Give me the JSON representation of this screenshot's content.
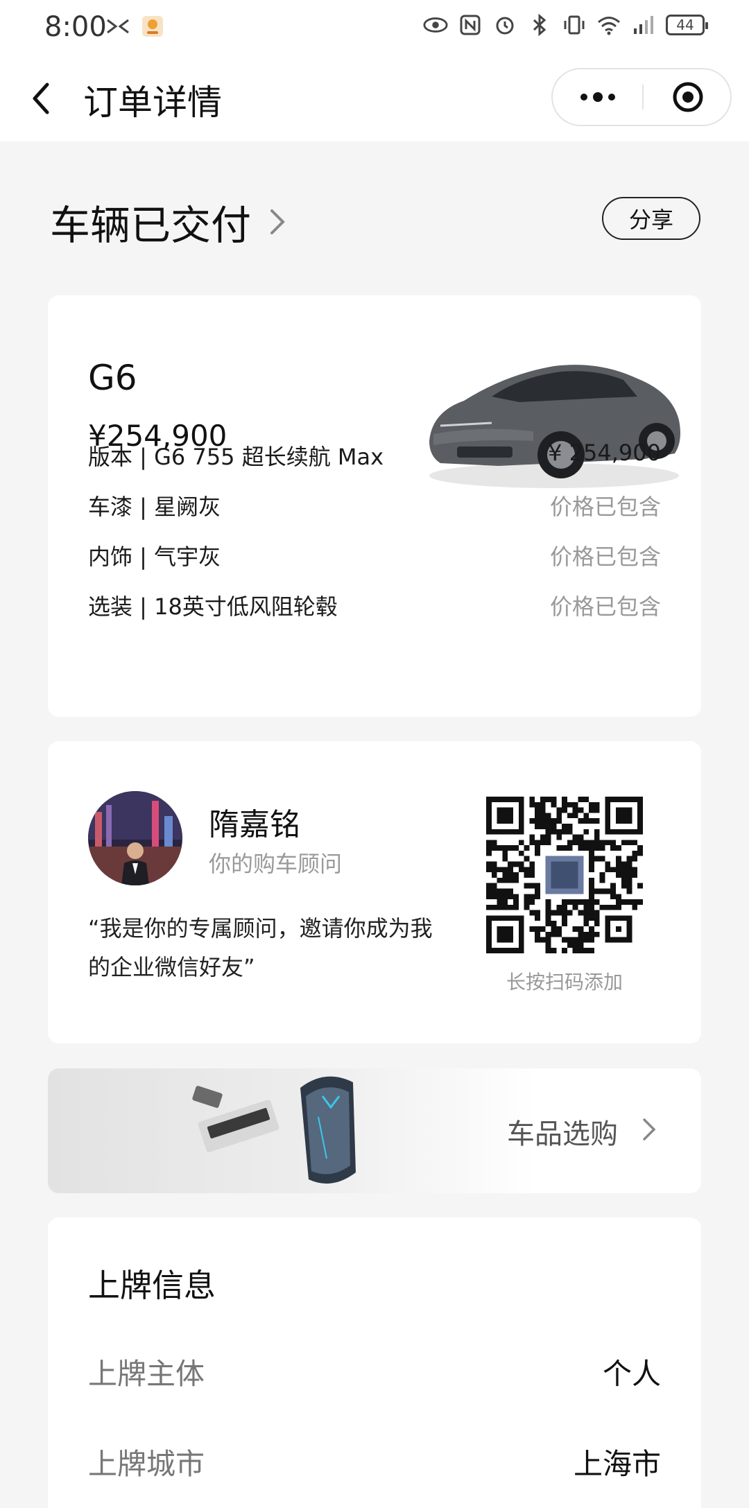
{
  "status_bar": {
    "time": "8:00",
    "battery": "44"
  },
  "nav": {
    "title": "订单详情"
  },
  "order": {
    "status": "车辆已交付",
    "share_label": "分享"
  },
  "car": {
    "model": "G6",
    "price": "¥254,900",
    "specs": [
      {
        "label": "版本 | G6 755 超长续航 Max",
        "value": "¥ 254,900",
        "muted": false
      },
      {
        "label": "车漆 | 星阙灰",
        "value": "价格已包含",
        "muted": true
      },
      {
        "label": "内饰 | 气宇灰",
        "value": "价格已包含",
        "muted": true
      },
      {
        "label": "选装 | 18英寸低风阻轮毂",
        "value": "价格已包含",
        "muted": true
      }
    ]
  },
  "advisor": {
    "name": "隋嘉铭",
    "role": "你的购车顾问",
    "quote": "“我是你的专属顾问，邀请你成为我的企业微信好友”",
    "qr_caption": "长按扫码添加"
  },
  "shop": {
    "label": "车品选购"
  },
  "registration": {
    "title": "上牌信息",
    "rows": [
      {
        "label": "上牌主体",
        "value": "个人"
      },
      {
        "label": "上牌城市",
        "value": "上海市"
      }
    ]
  },
  "icons": {
    "back": "chevron-left-icon",
    "more": "more-dots-icon",
    "close_target": "target-icon",
    "status_arrow": "chevron-right-icon"
  },
  "colors": {
    "page_bg": "#f5f5f5",
    "card_bg": "#ffffff",
    "muted_text": "#999999"
  }
}
